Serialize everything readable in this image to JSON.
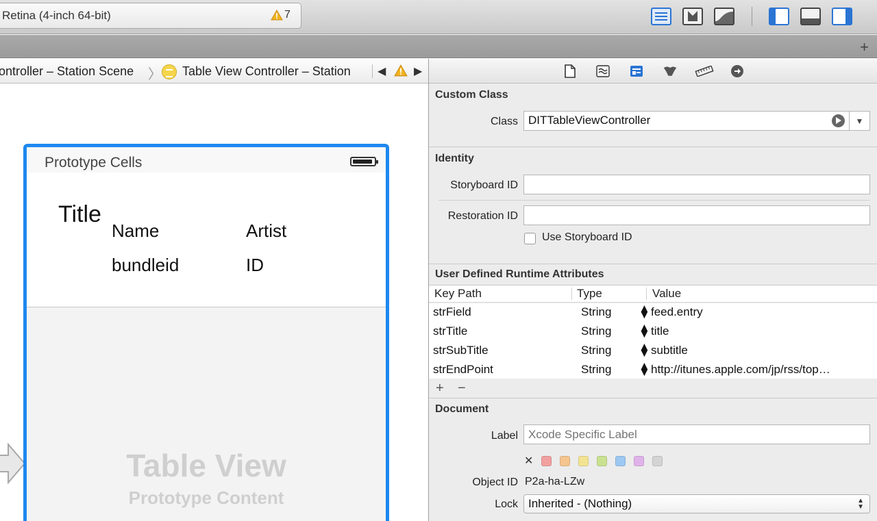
{
  "toolbar": {
    "scheme": "Retina (4-inch 64-bit)",
    "warning_count": "7"
  },
  "jumpbar": {
    "crumb_scene": "ontroller – Station Scene",
    "crumb_controller": "Table View Controller – Station"
  },
  "canvas": {
    "header": "Prototype Cells",
    "cell": {
      "title": "Title",
      "name": "Name",
      "artist": "Artist",
      "bundleid": "bundleid",
      "id": "ID"
    },
    "table_view_title": "Table View",
    "table_view_sub": "Prototype Content"
  },
  "inspector": {
    "custom_class": {
      "title": "Custom Class",
      "class_label": "Class",
      "class_value": "DITTableViewController"
    },
    "identity": {
      "title": "Identity",
      "storyboard_label": "Storyboard ID",
      "storyboard_value": "",
      "restoration_label": "Restoration ID",
      "restoration_value": "",
      "use_storyboard_label": "Use Storyboard ID"
    },
    "runtime": {
      "title": "User Defined Runtime Attributes",
      "col_keypath": "Key Path",
      "col_type": "Type",
      "col_value": "Value",
      "rows": [
        {
          "key": "strField",
          "type": "String",
          "value": "feed.entry"
        },
        {
          "key": "strTitle",
          "type": "String",
          "value": "title"
        },
        {
          "key": "strSubTitle",
          "type": "String",
          "value": "subtitle"
        },
        {
          "key": "strEndPoint",
          "type": "String",
          "value": "http://itunes.apple.com/jp/rss/top…"
        }
      ],
      "add": "+",
      "remove": "−"
    },
    "document": {
      "title": "Document",
      "label_label": "Label",
      "label_placeholder": "Xcode Specific Label",
      "object_id_label": "Object ID",
      "object_id_value": "P2a-ha-LZw",
      "lock_label": "Lock",
      "lock_value": "Inherited - (Nothing)"
    },
    "colors": [
      "#f2a0a0",
      "#f5c58e",
      "#f3e494",
      "#c9e290",
      "#9cc8f2",
      "#e0b3ea",
      "#d4d4d4"
    ]
  }
}
